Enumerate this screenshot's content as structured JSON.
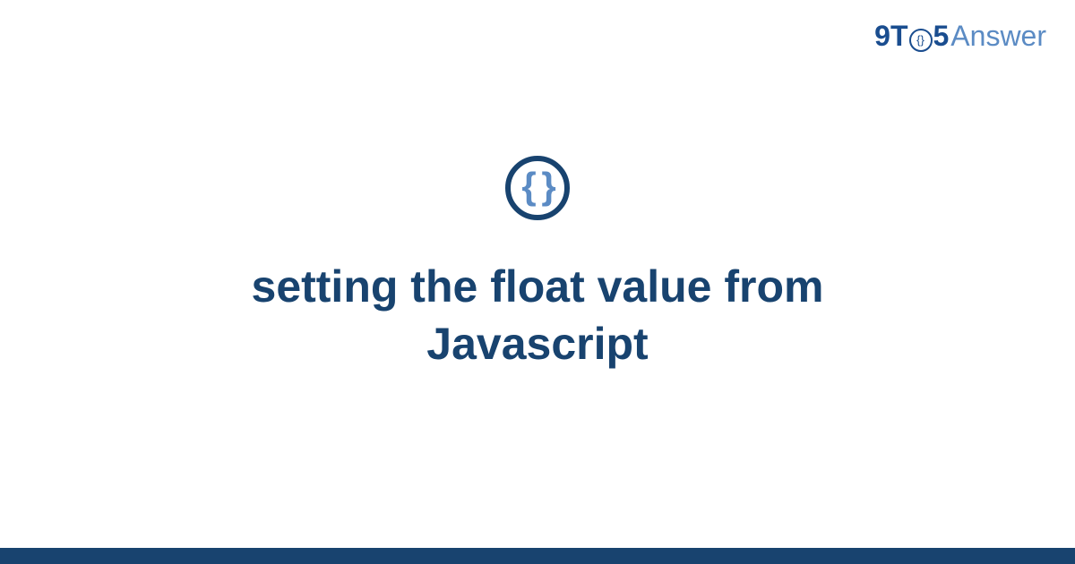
{
  "logo": {
    "part1": "9T",
    "circle_inner": "{}",
    "part2": "5",
    "part3": "Answer"
  },
  "icon": {
    "braces": "{ }"
  },
  "title": "setting the float value from Javascript",
  "colors": {
    "brand_dark": "#18436f",
    "brand_light": "#5b8bc4"
  }
}
